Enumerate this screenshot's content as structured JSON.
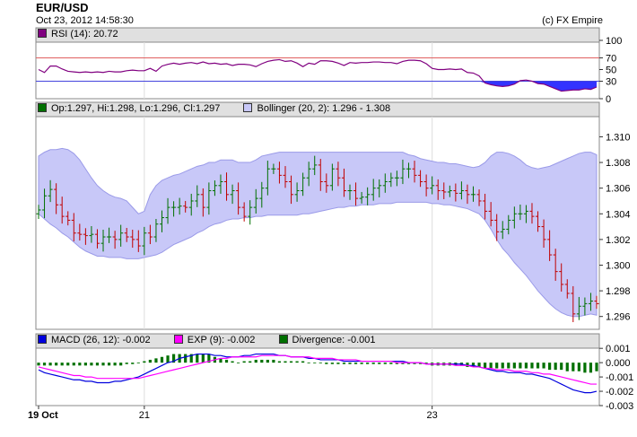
{
  "header": {
    "title": "EUR/USD",
    "datetime": "Oct 23, 2012 14:58:30",
    "credit": "(c) FX Empire"
  },
  "legends": {
    "rsi": "RSI (14): 20.72",
    "ohlc": "Op:1.297, Hi:1.298, Lo:1.296, Cl:1.297",
    "bollinger": "Bollinger (20, 2): 1.296 - 1.308",
    "macd": "MACD (26, 12): -0.002",
    "exp": "EXP (9): -0.002",
    "divergence": "Divergence: -0.001"
  },
  "colors": {
    "rsi": "#800080",
    "up": "#007000",
    "down": "#c00000",
    "band": "#c8c8f8",
    "macd": "#0000dd",
    "exp": "#ff00ff",
    "div": "#007000"
  },
  "chart_data": [
    {
      "type": "line",
      "name": "rsi",
      "ylim": [
        0,
        100
      ],
      "yticks": [
        "100",
        "70",
        "50",
        "30",
        "0"
      ],
      "tick_values": [
        100,
        70,
        50,
        30,
        0
      ],
      "levels": [
        70,
        30
      ],
      "values": [
        50,
        45,
        56,
        56,
        51,
        47,
        46,
        45,
        46,
        45,
        46,
        45,
        47,
        46,
        46,
        48,
        49,
        48,
        48,
        52,
        47,
        56,
        59,
        61,
        59,
        61,
        62,
        60,
        63,
        60,
        61,
        59,
        60,
        57,
        59,
        59,
        58,
        55,
        60,
        64,
        66,
        67,
        64,
        65,
        61,
        55,
        61,
        59,
        65,
        65,
        64,
        61,
        57,
        62,
        61,
        62,
        62,
        63,
        63,
        62,
        62,
        60,
        64,
        66,
        66,
        65,
        60,
        52,
        50,
        50,
        51,
        50,
        51,
        45,
        44,
        39,
        27,
        24,
        22,
        21,
        22,
        25,
        31,
        32,
        30,
        26,
        25,
        21,
        17,
        13,
        14,
        15,
        15,
        17,
        16,
        20
      ]
    },
    {
      "type": "line",
      "name": "price",
      "ylim": [
        1.295,
        1.3115
      ],
      "yticks": [
        "1.310",
        "1.308",
        "1.306",
        "1.304",
        "1.302",
        "1.300",
        "1.298",
        "1.296"
      ],
      "tick_values": [
        1.31,
        1.308,
        1.306,
        1.304,
        1.302,
        1.3,
        1.298,
        1.296
      ],
      "close": [
        1.3043,
        1.3054,
        1.3059,
        1.3047,
        1.3038,
        1.3035,
        1.3025,
        1.3024,
        1.3023,
        1.3024,
        1.3017,
        1.3022,
        1.3022,
        1.302,
        1.3025,
        1.3022,
        1.302,
        1.3015,
        1.3025,
        1.3022,
        1.3032,
        1.3037,
        1.3045,
        1.3045,
        1.3046,
        1.3045,
        1.305,
        1.3055,
        1.3045,
        1.3058,
        1.3062,
        1.3065,
        1.3055,
        1.3058,
        1.3045,
        1.3038,
        1.3045,
        1.3052,
        1.306,
        1.3075,
        1.3075,
        1.307,
        1.3065,
        1.3055,
        1.3058,
        1.3068,
        1.3075,
        1.3078,
        1.3065,
        1.3062,
        1.3075,
        1.3068,
        1.3058,
        1.3058,
        1.3052,
        1.3053,
        1.3055,
        1.306,
        1.3062,
        1.3065,
        1.3068,
        1.3068,
        1.3075,
        1.3075,
        1.307,
        1.3065,
        1.306,
        1.3062,
        1.3058,
        1.3057,
        1.3058,
        1.3056,
        1.3058,
        1.3055,
        1.3055,
        1.305,
        1.3042,
        1.3035,
        1.3026,
        1.3028,
        1.3035,
        1.304,
        1.304,
        1.3042,
        1.3038,
        1.303,
        1.302,
        1.3008,
        1.2995,
        1.2985,
        1.2978,
        1.2962,
        1.2968,
        1.297,
        1.2972,
        1.297
      ],
      "band_upper": [
        1.3085,
        1.3088,
        1.309,
        1.309,
        1.3091,
        1.309,
        1.3087,
        1.3082,
        1.3075,
        1.3068,
        1.3062,
        1.3058,
        1.3055,
        1.3053,
        1.3052,
        1.305,
        1.3045,
        1.304,
        1.3042,
        1.3055,
        1.3062,
        1.3066,
        1.3068,
        1.307,
        1.3071,
        1.3073,
        1.3075,
        1.3077,
        1.3078,
        1.308,
        1.308,
        1.3082,
        1.3082,
        1.3082,
        1.308,
        1.308,
        1.308,
        1.3082,
        1.3085,
        1.3086,
        1.3087,
        1.3088,
        1.3088,
        1.3088,
        1.3088,
        1.3088,
        1.3088,
        1.3088,
        1.3088,
        1.3088,
        1.3088,
        1.3088,
        1.3088,
        1.3088,
        1.3088,
        1.3088,
        1.3088,
        1.3088,
        1.3088,
        1.3088,
        1.3088,
        1.3088,
        1.3088,
        1.3086,
        1.3085,
        1.3083,
        1.3082,
        1.3081,
        1.308,
        1.308,
        1.3079,
        1.3079,
        1.3078,
        1.3077,
        1.3076,
        1.3077,
        1.308,
        1.3085,
        1.3088,
        1.3088,
        1.3087,
        1.3085,
        1.3082,
        1.3078,
        1.3076,
        1.3075,
        1.3076,
        1.3077,
        1.3079,
        1.3081,
        1.3083,
        1.3085,
        1.3087,
        1.3088,
        1.3088,
        1.3086
      ],
      "band_lower": [
        1.304,
        1.3036,
        1.3032,
        1.3029,
        1.3025,
        1.3022,
        1.3018,
        1.3014,
        1.3011,
        1.3009,
        1.3007,
        1.3007,
        1.3006,
        1.3006,
        1.3006,
        1.3005,
        1.3005,
        1.3005,
        1.3006,
        1.3007,
        1.3008,
        1.301,
        1.3013,
        1.3016,
        1.3018,
        1.302,
        1.3022,
        1.3025,
        1.3027,
        1.303,
        1.3032,
        1.3033,
        1.3035,
        1.3036,
        1.3036,
        1.3037,
        1.3037,
        1.3038,
        1.3038,
        1.3039,
        1.3039,
        1.3039,
        1.3039,
        1.3039,
        1.3039,
        1.304,
        1.304,
        1.3041,
        1.3042,
        1.3043,
        1.3044,
        1.3045,
        1.3045,
        1.3046,
        1.3046,
        1.3047,
        1.3047,
        1.3047,
        1.3048,
        1.3048,
        1.3048,
        1.3049,
        1.3049,
        1.3049,
        1.3049,
        1.3049,
        1.3049,
        1.3048,
        1.3048,
        1.3047,
        1.3047,
        1.3046,
        1.3045,
        1.3044,
        1.3042,
        1.304,
        1.3035,
        1.3028,
        1.302,
        1.3013,
        1.3008,
        1.3002,
        1.2997,
        1.2992,
        1.2986,
        1.298,
        1.2975,
        1.297,
        1.2966,
        1.2963,
        1.2961,
        1.296,
        1.296,
        1.2961,
        1.2962,
        1.2961
      ]
    },
    {
      "type": "line",
      "name": "macd",
      "ylim": [
        -0.003,
        0.0012
      ],
      "yticks": [
        "0.001",
        "0.000",
        "-0.001",
        "-0.002",
        "-0.003"
      ],
      "tick_values": [
        0.001,
        0.0,
        -0.001,
        -0.002,
        -0.003
      ],
      "macd": [
        -0.0005,
        -0.0007,
        -0.0008,
        -0.0009,
        -0.001,
        -0.0011,
        -0.0012,
        -0.0012,
        -0.0013,
        -0.0013,
        -0.0014,
        -0.0014,
        -0.0014,
        -0.0013,
        -0.0013,
        -0.0012,
        -0.0011,
        -0.001,
        -0.0008,
        -0.0006,
        -0.0004,
        -0.0002,
        0.0,
        0.0001,
        0.0003,
        0.0004,
        0.0005,
        0.0006,
        0.0006,
        0.0006,
        0.0005,
        0.0005,
        0.0004,
        0.0004,
        0.0004,
        0.0005,
        0.0005,
        0.0006,
        0.0006,
        0.0006,
        0.0006,
        0.0005,
        0.0005,
        0.0004,
        0.0004,
        0.0004,
        0.0003,
        0.0003,
        0.0002,
        0.0002,
        0.0002,
        0.0002,
        0.0001,
        0.0001,
        0.0001,
        0.0001,
        0.0001,
        0.0001,
        0.0001,
        0.0001,
        0.0001,
        0.0001,
        0.0001,
        0.0,
        0.0,
        0.0,
        -0.0001,
        -0.0001,
        -0.0001,
        -0.0001,
        -0.0001,
        -0.0001,
        -0.0001,
        -0.0002,
        -0.0002,
        -0.0003,
        -0.0004,
        -0.0005,
        -0.0006,
        -0.0006,
        -0.0007,
        -0.0007,
        -0.0007,
        -0.0008,
        -0.0008,
        -0.0009,
        -0.001,
        -0.0011,
        -0.0013,
        -0.0015,
        -0.0017,
        -0.0019,
        -0.002,
        -0.0021,
        -0.0021,
        -0.002
      ],
      "exp": [
        -0.0003,
        -0.0004,
        -0.0005,
        -0.0006,
        -0.0007,
        -0.0008,
        -0.0009,
        -0.0009,
        -0.001,
        -0.001,
        -0.0011,
        -0.0011,
        -0.0011,
        -0.0011,
        -0.0011,
        -0.0011,
        -0.0011,
        -0.0011,
        -0.001,
        -0.0009,
        -0.0008,
        -0.0007,
        -0.0006,
        -0.0005,
        -0.0004,
        -0.0003,
        -0.0002,
        -0.0001,
        0.0,
        0.0001,
        0.0002,
        0.0003,
        0.0003,
        0.0004,
        0.0004,
        0.0004,
        0.0004,
        0.0004,
        0.0005,
        0.0005,
        0.0005,
        0.0005,
        0.0005,
        0.0004,
        0.0004,
        0.0004,
        0.0004,
        0.0003,
        0.0003,
        0.0003,
        0.0003,
        0.0002,
        0.0002,
        0.0002,
        0.0002,
        0.0001,
        0.0001,
        0.0001,
        0.0001,
        0.0001,
        0.0001,
        0.0,
        0.0,
        0.0,
        0.0,
        0.0,
        -0.0001,
        -0.0001,
        -0.0001,
        -0.0001,
        -0.0001,
        -0.0002,
        -0.0002,
        -0.0002,
        -0.0003,
        -0.0003,
        -0.0004,
        -0.0004,
        -0.0005,
        -0.0005,
        -0.0005,
        -0.0006,
        -0.0006,
        -0.0006,
        -0.0007,
        -0.0007,
        -0.0008,
        -0.0008,
        -0.0009,
        -0.001,
        -0.0011,
        -0.0012,
        -0.0013,
        -0.0014,
        -0.0015,
        -0.0015
      ],
      "divergence": [
        -0.0002,
        -0.0002,
        -0.0002,
        -0.0002,
        -0.0002,
        -0.0002,
        -0.0002,
        -0.0002,
        -0.0002,
        -0.0002,
        -0.0002,
        -0.0002,
        -0.0002,
        -0.0002,
        -0.0002,
        -0.0001,
        -0.0001,
        0.0,
        0.0001,
        0.0002,
        0.0003,
        0.0004,
        0.0005,
        0.0006,
        0.0006,
        0.0006,
        0.0006,
        0.0006,
        0.0006,
        0.0006,
        0.0004,
        0.0003,
        0.0002,
        0.0001,
        0.0,
        0.0001,
        0.0001,
        0.0002,
        0.0002,
        0.0002,
        0.0002,
        0.0001,
        0.0001,
        0.0001,
        0.0001,
        0.0001,
        0.0,
        0.0,
        0.0,
        -0.0001,
        -0.0001,
        -0.0001,
        -0.0001,
        -0.0001,
        -0.0001,
        -0.0001,
        -0.0001,
        -0.0001,
        -0.0001,
        -0.0001,
        -0.0001,
        -0.0001,
        -0.0001,
        -0.0001,
        -0.0001,
        -0.0001,
        -0.0001,
        -0.0002,
        -0.0002,
        -0.0002,
        -0.0002,
        -0.0002,
        -0.0002,
        -0.0003,
        -0.0003,
        -0.0003,
        -0.0004,
        -0.0004,
        -0.0004,
        -0.0004,
        -0.0004,
        -0.0004,
        -0.0004,
        -0.0004,
        -0.0004,
        -0.0004,
        -0.0004,
        -0.0005,
        -0.0005,
        -0.0005,
        -0.0006,
        -0.0006,
        -0.0006,
        -0.0007,
        -0.0007,
        -0.0006
      ]
    }
  ],
  "x_axis": {
    "labels": [
      {
        "text": "19 Oct",
        "index": 0,
        "bold": true
      },
      {
        "text": "21",
        "index": 18,
        "bold": false
      },
      {
        "text": "23",
        "index": 67,
        "bold": false
      }
    ]
  }
}
